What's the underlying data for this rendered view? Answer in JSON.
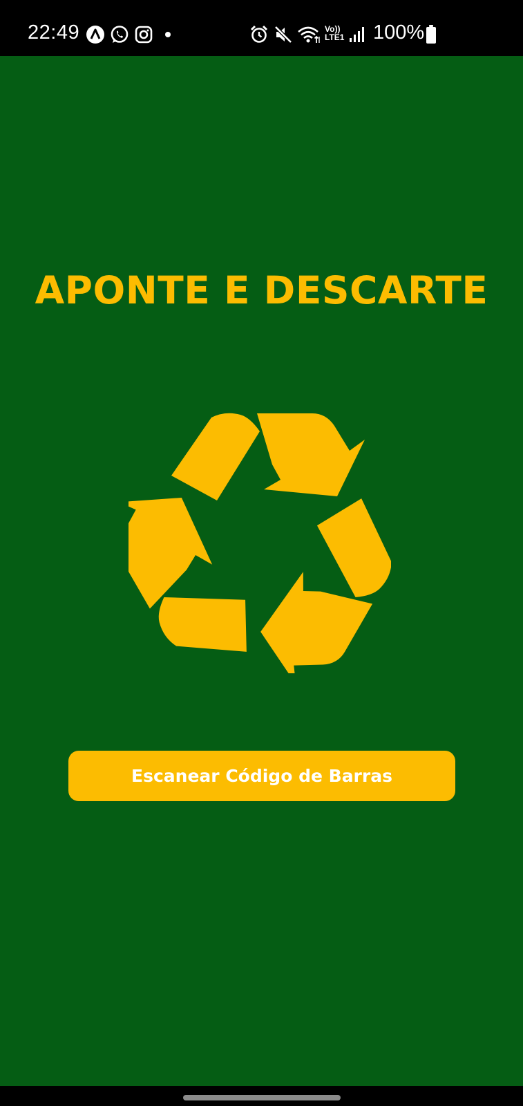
{
  "status_bar": {
    "time": "22:49",
    "battery_percent": "100%",
    "network_label_top": "Vo))",
    "network_label_bottom": "LTE1",
    "notification_icons": [
      "app-a-icon",
      "whatsapp-icon",
      "instagram-icon",
      "dot-icon"
    ],
    "system_icons": [
      "alarm-icon",
      "mute-icon",
      "wifi-icon",
      "signal-icon",
      "battery-icon"
    ]
  },
  "main": {
    "title": "APONTE E DESCARTE",
    "logo_icon": "recycle-icon",
    "scan_button_label": "Escanear Código de Barras"
  },
  "colors": {
    "background": "#055d14",
    "accent": "#fcbc01",
    "button_text": "#ffffff"
  }
}
